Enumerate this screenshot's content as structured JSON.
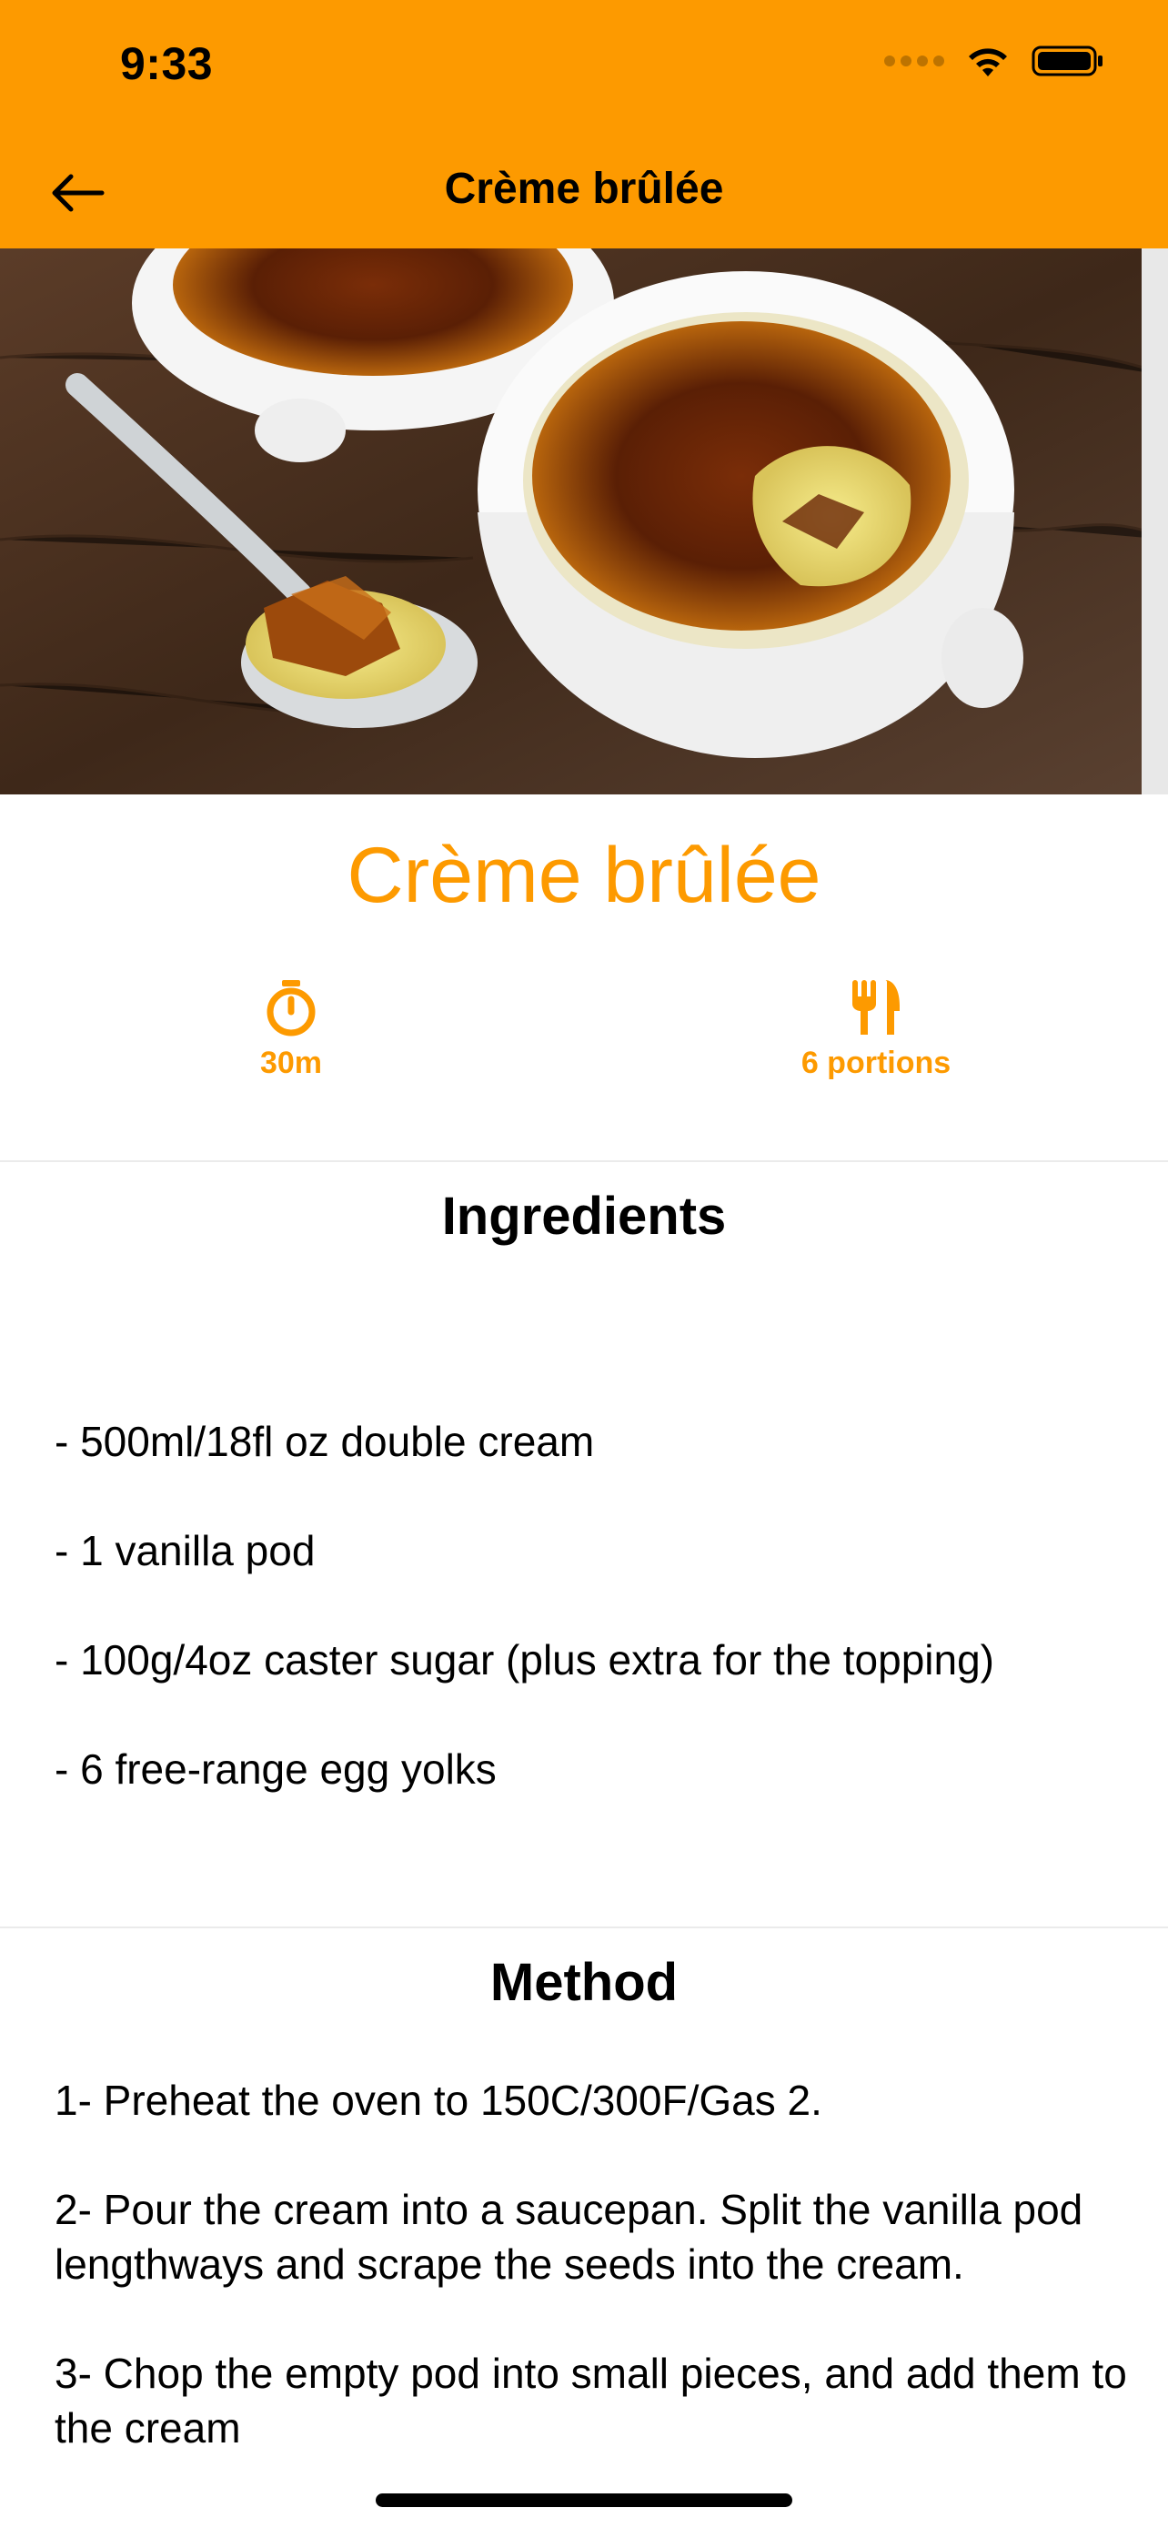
{
  "status_bar": {
    "time": "9:33"
  },
  "nav": {
    "title": "Crème brûlée"
  },
  "recipe": {
    "title": "Crème brûlée",
    "time": "30m",
    "portions": "6 portions"
  },
  "ingredients": {
    "heading": "Ingredients",
    "items": [
      "- 500ml/18fl oz double cream",
      "- 1 vanilla pod",
      "- 100g/4oz caster sugar (plus extra for the topping)",
      "- 6 free-range egg yolks"
    ]
  },
  "method": {
    "heading": "Method",
    "steps": [
      "1- Preheat the oven to 150C/300F/Gas 2.",
      "2- Pour the cream into a saucepan. Split the vanilla pod lengthways and scrape the seeds into the cream.",
      "3- Chop the empty pod into small pieces, and add them to the cream"
    ]
  },
  "colors": {
    "accent": "#fd9a00",
    "divider": "#ebebeb"
  },
  "icons": {
    "back": "arrow-left-icon",
    "timer": "stopwatch-icon",
    "portions": "fork-knife-icon",
    "wifi": "wifi-icon",
    "battery": "battery-icon",
    "signal": "signal-icon"
  }
}
